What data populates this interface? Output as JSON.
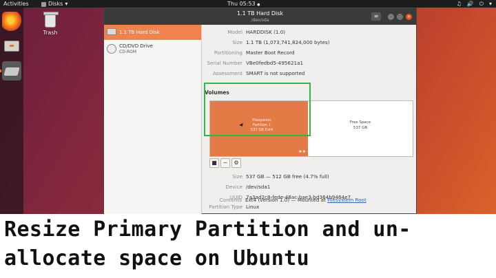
{
  "topbar": {
    "activities": "Activities",
    "app_menu": "Disks",
    "app_menu_arrow": "▾",
    "clock": "Thu 05:53",
    "clock_arrow": "●",
    "tray": [
      "♫",
      "🔊",
      "⏻"
    ],
    "tray_arrow": "▾"
  },
  "desktop": {
    "trash_label": "Trash"
  },
  "window": {
    "title": "1.1 TB Hard Disk",
    "subtitle": "/dev/sda",
    "menu_icon": "≡",
    "min_icon": "–",
    "max_icon": "□",
    "close_icon": "×"
  },
  "sidebar": {
    "devices": [
      {
        "name": "1.1 TB Hard Disk",
        "detail": "",
        "selected": true
      },
      {
        "name": "CD/DVD Drive",
        "detail": "CD-ROM",
        "selected": false
      }
    ]
  },
  "disk_info": [
    {
      "key": "Model",
      "value": "HARDDISK (1.0)"
    },
    {
      "key": "Size",
      "value": "1.1 TB (1,073,741,824,000 bytes)"
    },
    {
      "key": "Partitioning",
      "value": "Master Boot Record"
    },
    {
      "key": "Serial Number",
      "value": "VBe0fedbd5-495621a1"
    },
    {
      "key": "Assessment",
      "value": "SMART is not supported"
    }
  ],
  "volumes": {
    "heading": "Volumes",
    "partition1": {
      "line1": "Filesystem",
      "line2": "Partition 1",
      "line3": "537 GB Ext4",
      "stars": "★★"
    },
    "partition2": {
      "line1": "Free Space",
      "line2": "537 GB"
    },
    "tools": [
      "■",
      "−",
      "⚙"
    ]
  },
  "partition_info": [
    {
      "key": "Size",
      "value": "537 GB — 512 GB free (4.7% full)"
    },
    {
      "key": "Device",
      "value": "/dev/sda1"
    },
    {
      "key": "UUID",
      "value": "7a3ad2c8-fede-48ac-bae3-bd364b9464e7"
    },
    {
      "key": "Partition Type",
      "value": "Linux"
    },
    {
      "key": "Contents",
      "value": "Ext4 (version 1.0) — Mounted at ",
      "link": "Filesystem Root"
    }
  ],
  "caption": {
    "line1": "Resize Primary Partition and un-",
    "line2": "allocate space on Ubuntu"
  },
  "colors": {
    "accent": "#f0834d",
    "partition": "#e47a45",
    "highlight": "#2fb84a",
    "link": "#2a64b4"
  }
}
